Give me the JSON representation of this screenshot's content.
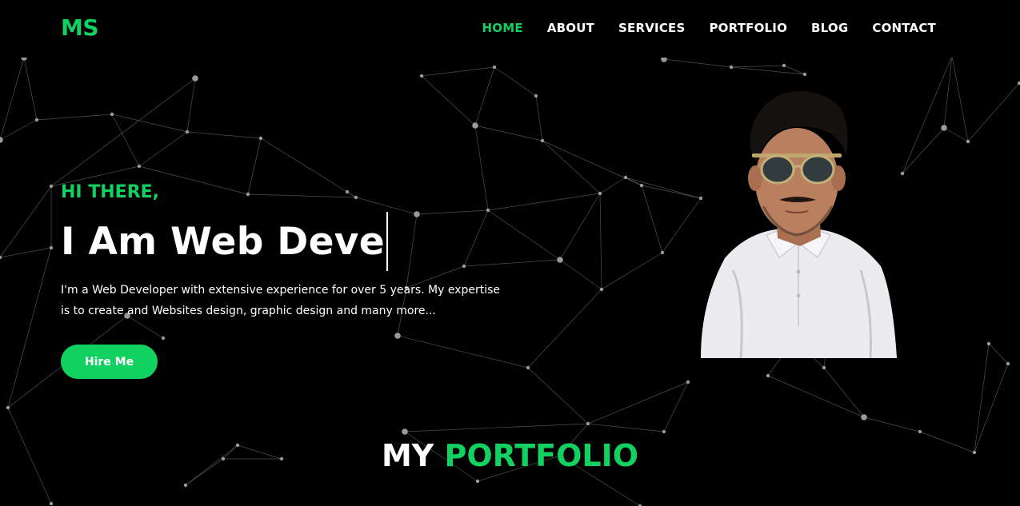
{
  "brand": {
    "logo": "MS",
    "accent_color": "#11d160"
  },
  "nav": {
    "items": [
      {
        "label": "HOME",
        "active": true
      },
      {
        "label": "ABOUT",
        "active": false
      },
      {
        "label": "SERVICES",
        "active": false
      },
      {
        "label": "PORTFOLIO",
        "active": false
      },
      {
        "label": "BLOG",
        "active": false
      },
      {
        "label": "CONTACT",
        "active": false
      }
    ]
  },
  "hero": {
    "greeting": "HI THERE,",
    "headline_typed": "I Am Web Deve",
    "intro": "I'm a Web Developer with extensive experience for over 5 years. My expertise is to create and Websites design, graphic design and many more...",
    "cta_label": "Hire Me",
    "photo": {
      "icon": "profile-photo",
      "description": "portrait of man in sunglasses and white shirt"
    }
  },
  "portfolio_section": {
    "title_white": "MY",
    "title_green": "PORTFOLIO"
  }
}
